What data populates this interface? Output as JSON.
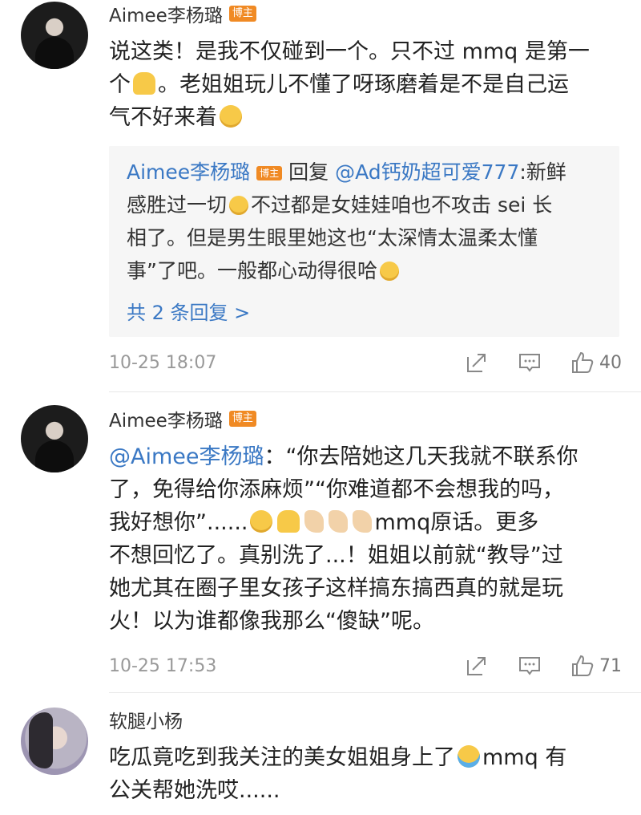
{
  "comments": [
    {
      "user": "Aimee李杨璐",
      "badge": "博主",
      "text_lines": [
        "说这类！是我不仅碰到一个。只不过 mmq 是第一",
        "个",
        "。老姐姐玩儿不懂了呀琢磨着是不是自己运",
        "气不好来着"
      ],
      "reply": {
        "author": "Aimee李杨璐",
        "badge": "博主",
        "prefix": "回复",
        "mention": "@Ad钙奶超可爱777",
        "text_a": ":新鲜",
        "text_b": "感胜过一切",
        "text_c": "不过都是女娃娃咱也不攻击 sei 长",
        "text_d": "相了。但是男生眼里她这也“太深情太温柔太懂",
        "text_e": "事”了吧。一般都心动得很哈",
        "more": "共 2 条回复 >"
      },
      "time": "10-25 18:07",
      "likes": "40"
    },
    {
      "user": "Aimee李杨璐",
      "badge": "博主",
      "mention": "@Aimee李杨璐",
      "line1_rest": "：“你去陪她这几天我就不联系你",
      "line2": "了，免得给你添麻烦”“你难道都不会想我的吗，",
      "line3a": "我好想你”......",
      "line3b": "mmq原话。更多",
      "line4": "不想回忆了。真别洗了...！姐姐以前就“教导”过",
      "line5": "她尤其在圈子里女孩子这样搞东搞西真的就是玩",
      "line6": "火！以为谁都像我那么“傻缺”呢。",
      "time": "10-25 17:53",
      "likes": "71"
    },
    {
      "user": "软腿小杨",
      "line1a": "吃瓜竟吃到我关注的美女姐姐身上了",
      "line1b": "mmq 有",
      "line2": "公关帮她洗哎......"
    }
  ],
  "icons": [
    "share-icon",
    "comment-icon",
    "like-icon"
  ],
  "colors": {
    "link": "#3a78c4",
    "badge": "#f08a24",
    "meta": "#999999"
  }
}
